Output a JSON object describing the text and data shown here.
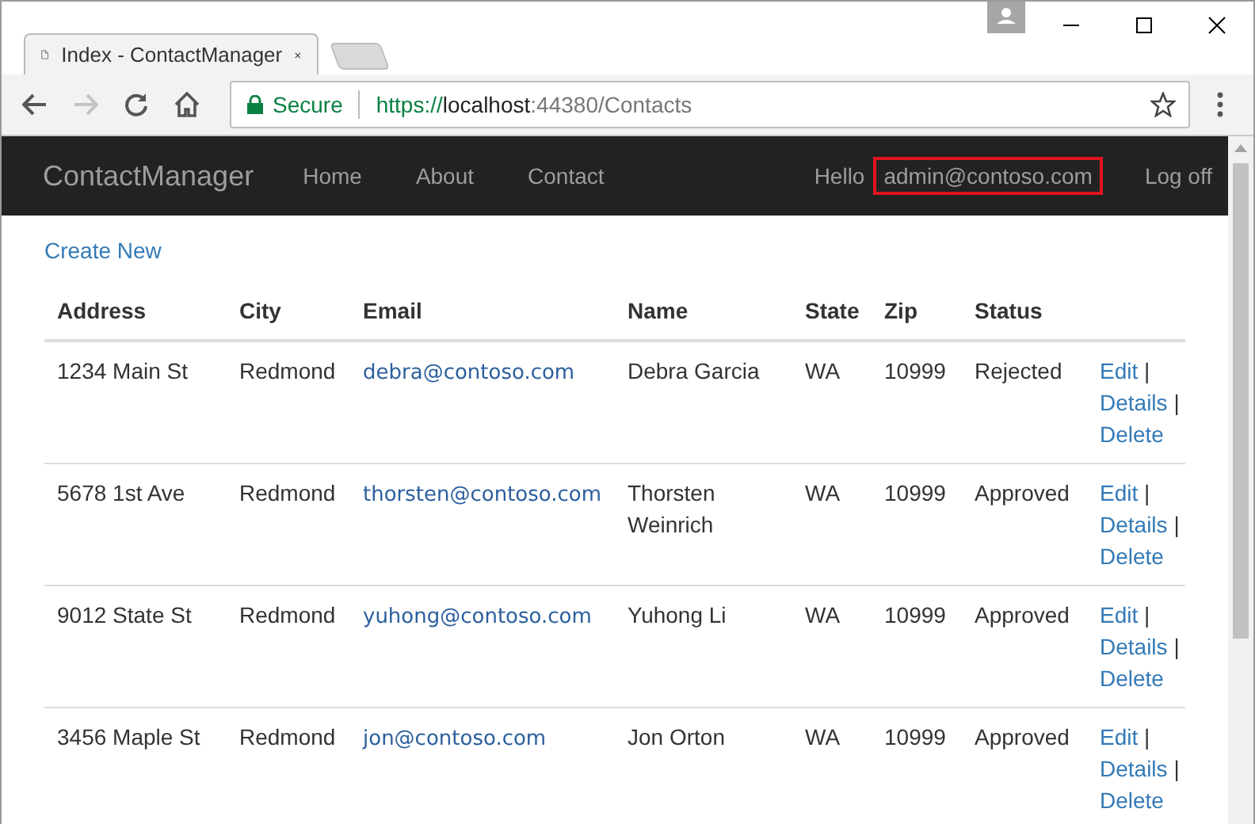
{
  "browser": {
    "tab_title": "Index - ContactManager",
    "secure_label": "Secure",
    "url_scheme": "https://",
    "url_host": "localhost",
    "url_path": ":44380/Contacts"
  },
  "navbar": {
    "brand": "ContactManager",
    "links": [
      "Home",
      "About",
      "Contact"
    ],
    "greeting": "Hello",
    "user": "admin@contoso.com",
    "logoff": "Log off"
  },
  "content": {
    "create_new": "Create New",
    "table": {
      "columns": [
        "Address",
        "City",
        "Email",
        "Name",
        "State",
        "Zip",
        "Status"
      ],
      "rows": [
        {
          "address": "1234 Main St",
          "city": "Redmond",
          "email": "debra@contoso.com",
          "name": "Debra Garcia",
          "state": "WA",
          "zip": "10999",
          "status": "Rejected",
          "actions": [
            {
              "label": "Edit",
              "separator": "|"
            },
            {
              "label": "Details",
              "separator": "|"
            },
            {
              "label": "Delete"
            }
          ]
        },
        {
          "address": "5678 1st Ave",
          "city": "Redmond",
          "email": "thorsten@contoso.com",
          "name": "Thorsten Weinrich",
          "state": "WA",
          "zip": "10999",
          "status": "Approved",
          "actions": [
            {
              "label": "Edit",
              "separator": "|"
            },
            {
              "label": "Details",
              "separator": "|"
            },
            {
              "label": "Delete"
            }
          ]
        },
        {
          "address": "9012 State St",
          "city": "Redmond",
          "email": "yuhong@contoso.com",
          "name": "Yuhong Li",
          "state": "WA",
          "zip": "10999",
          "status": "Approved",
          "actions": [
            {
              "label": "Edit",
              "separator": "|"
            },
            {
              "label": "Details",
              "separator": "|"
            },
            {
              "label": "Delete"
            }
          ]
        },
        {
          "address": "3456 Maple St",
          "city": "Redmond",
          "email": "jon@contoso.com",
          "name": "Jon Orton",
          "state": "WA",
          "zip": "10999",
          "status": "Approved",
          "actions": [
            {
              "label": "Edit",
              "separator": "|"
            },
            {
              "label": "Details",
              "separator": "|"
            },
            {
              "label": "Delete"
            }
          ]
        }
      ]
    }
  }
}
